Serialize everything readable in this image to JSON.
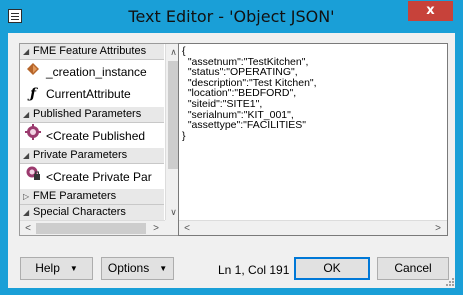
{
  "window": {
    "title": "Text Editor - 'Object JSON'",
    "close_glyph": "x"
  },
  "tree": {
    "sections": [
      {
        "label": "FME Feature Attributes",
        "expanded": true
      },
      {
        "label": "Published Parameters",
        "expanded": true
      },
      {
        "label": "Private Parameters",
        "expanded": true
      },
      {
        "label": "FME Parameters",
        "expanded": false
      },
      {
        "label": "Special Characters",
        "expanded": true
      }
    ],
    "items": {
      "creation_instance": "_creation_instance",
      "current_attribute": "CurrentAttribute",
      "create_published": "<Create Published",
      "create_private": "<Create Private Par"
    },
    "icons": {
      "creation_instance": "orange-diamond-attribute-icon",
      "current_attribute": "function-icon",
      "create_published": "parameter-gear-icon",
      "create_private": "private-parameter-icon"
    }
  },
  "editor": {
    "lines": [
      "{",
      "  \"assetnum\":\"TestKitchen\",",
      "  \"status\":\"OPERATING\",",
      "  \"description\":\"Test Kitchen\",",
      "  \"location\":\"BEDFORD\",",
      "  \"siteid\":\"SITE1\",",
      "  \"serialnum\":\"KIT_001\",",
      "  \"assettype\":\"FACILITIES\"",
      "}"
    ]
  },
  "footer": {
    "help_label": "Help",
    "options_label": "Options",
    "cursor_status": "Ln 1, Col 191",
    "ok_label": "OK",
    "cancel_label": "Cancel"
  },
  "colors": {
    "titlebar": "#1a9fd7",
    "close_button": "#c7423a",
    "dialog_background": "#f0f0f0",
    "primary_border": "#0078d7"
  }
}
